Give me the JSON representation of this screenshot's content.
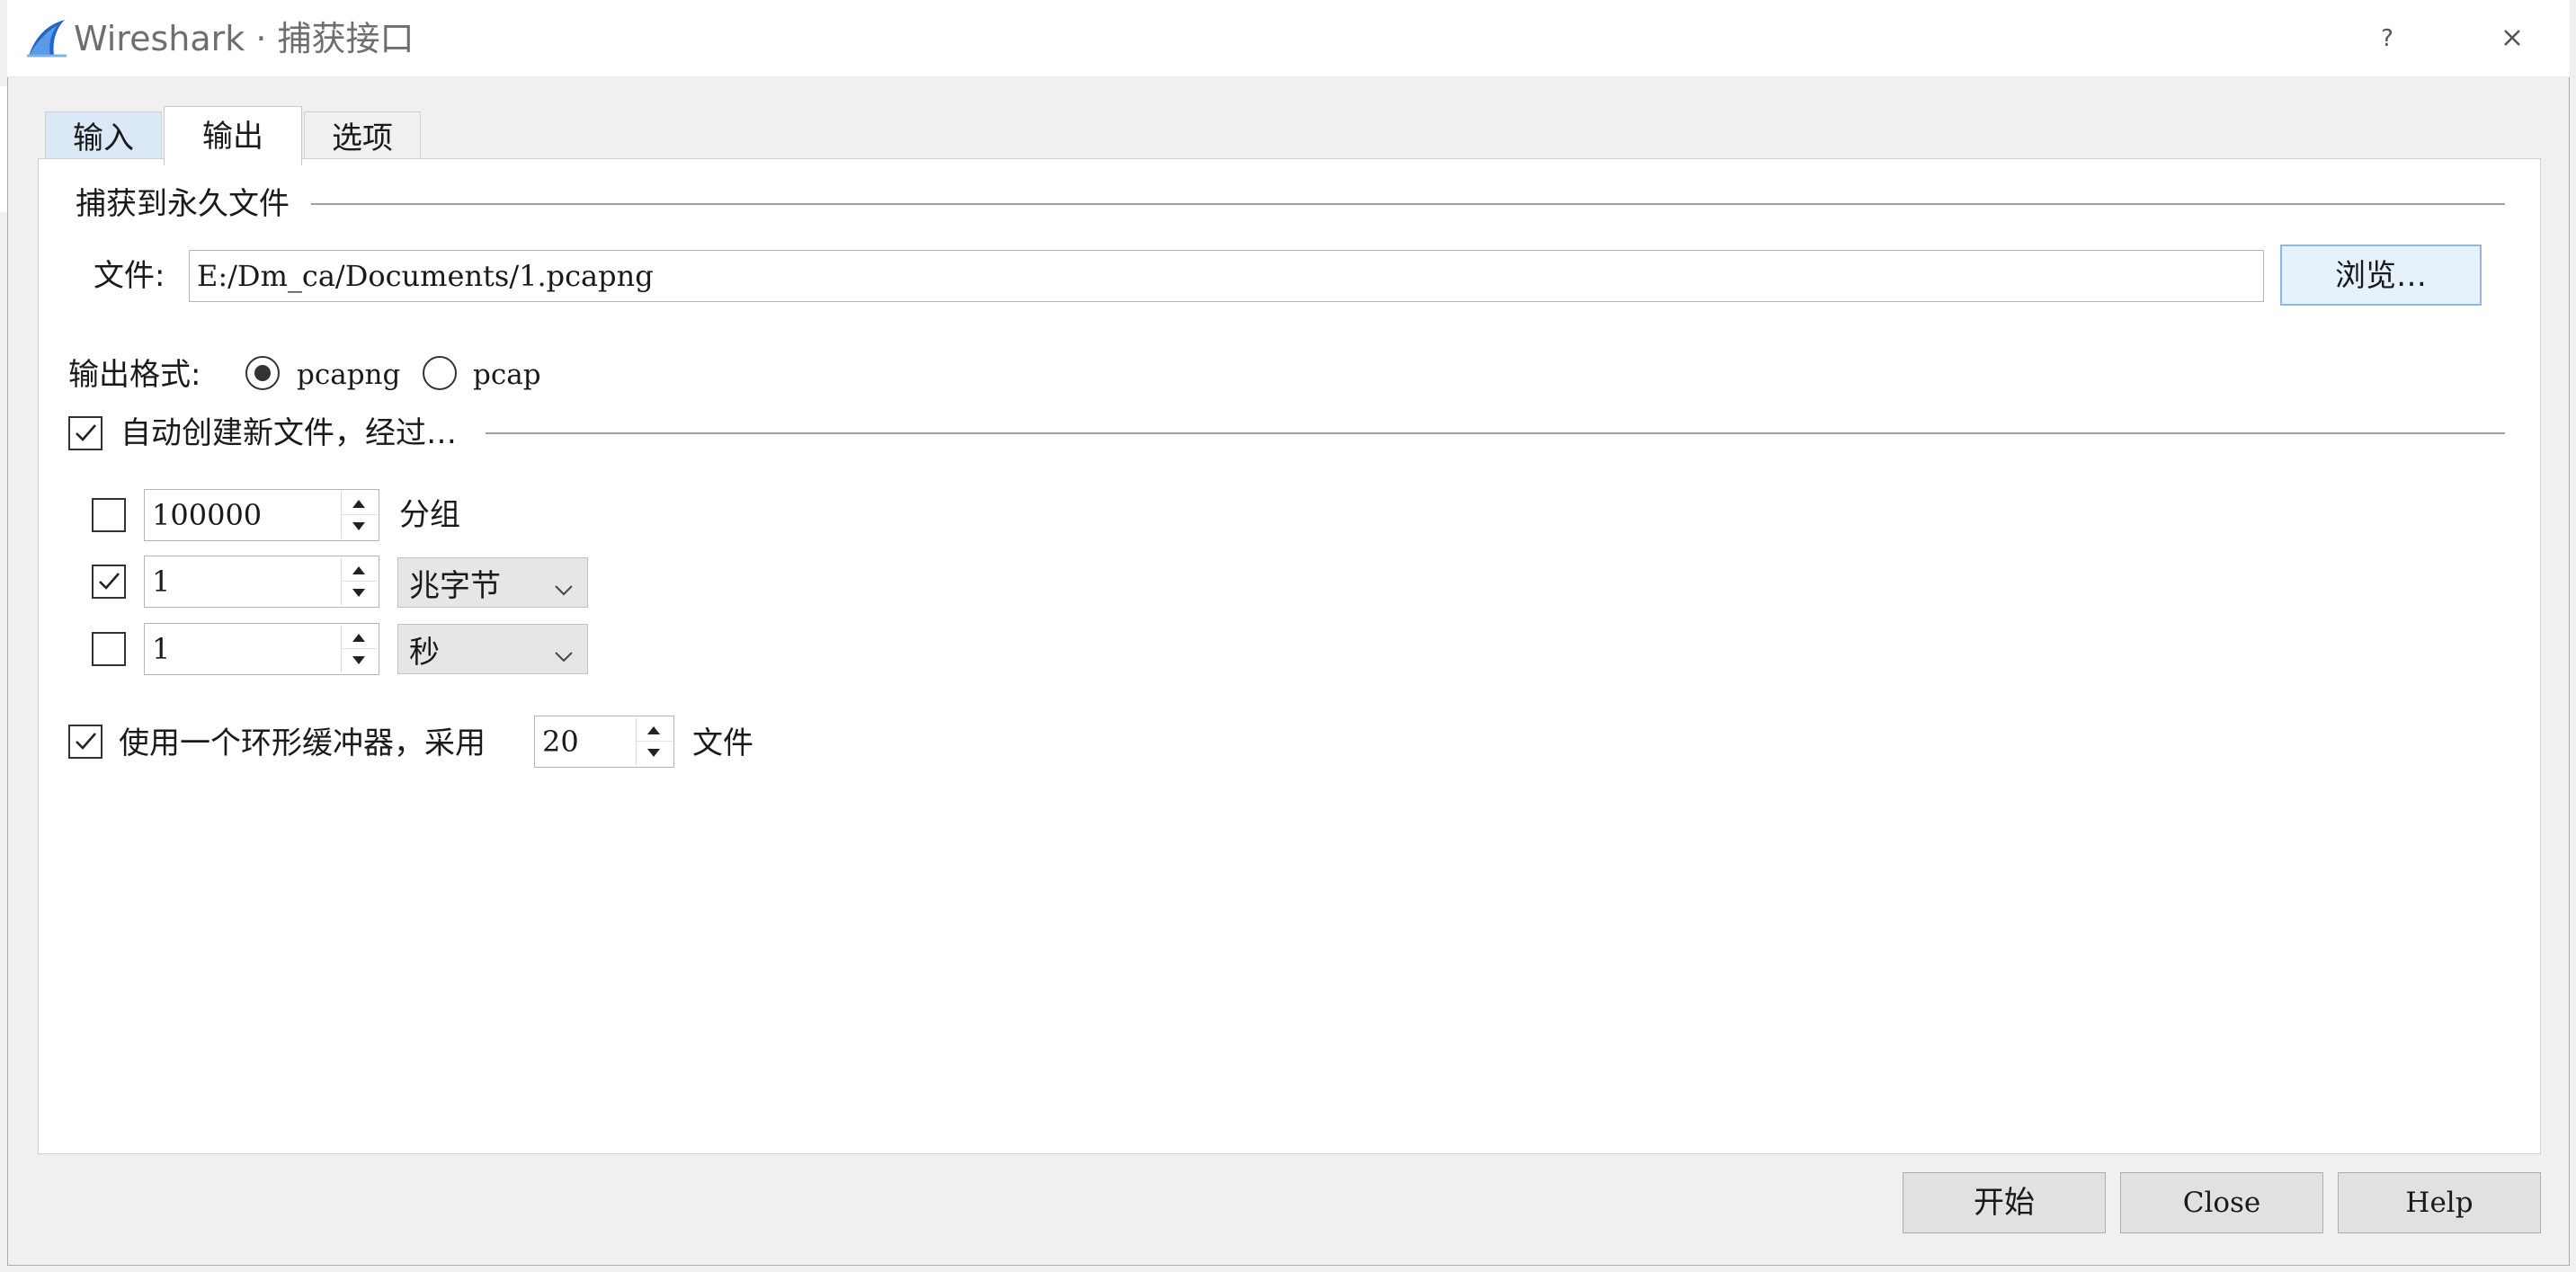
{
  "window": {
    "title": "Wireshark · 捕获接口",
    "help_glyph": "?",
    "icons": {
      "logo": "wireshark-fin-logo",
      "help": "help-icon",
      "close": "close-icon"
    }
  },
  "tabs": [
    {
      "label": "输入",
      "selected": false
    },
    {
      "label": "输出",
      "selected": true
    },
    {
      "label": "选项",
      "selected": false
    }
  ],
  "capture_file": {
    "group_label": "捕获到永久文件",
    "file_label": "文件:",
    "file_value": "E:/Dm_ca/Documents/1.pcapng",
    "browse_label": "浏览…"
  },
  "output_format": {
    "label": "输出格式:",
    "options": [
      {
        "label": "pcapng",
        "selected": true
      },
      {
        "label": "pcap",
        "selected": false
      }
    ]
  },
  "auto_new_file": {
    "label": "自动创建新文件，经过…",
    "checked": true,
    "rows": [
      {
        "checked": false,
        "value": "100000",
        "unit": "分组",
        "unit_is_dropdown": false
      },
      {
        "checked": true,
        "value": "1",
        "unit": "兆字节",
        "unit_is_dropdown": true
      },
      {
        "checked": false,
        "value": "1",
        "unit": "秒",
        "unit_is_dropdown": true
      }
    ]
  },
  "ring_buffer": {
    "checked": true,
    "label": "使用一个环形缓冲器，采用",
    "value": "20",
    "unit": "文件"
  },
  "footer": {
    "start_label": "开始",
    "close_label": "Close",
    "help_label": "Help"
  },
  "colors": {
    "accent_selected_tab": "#dbe9f7",
    "browse_button_bg": "#e5f1fb",
    "browse_button_border": "#8fb8e0",
    "logo_blue": "#1f66c7"
  }
}
